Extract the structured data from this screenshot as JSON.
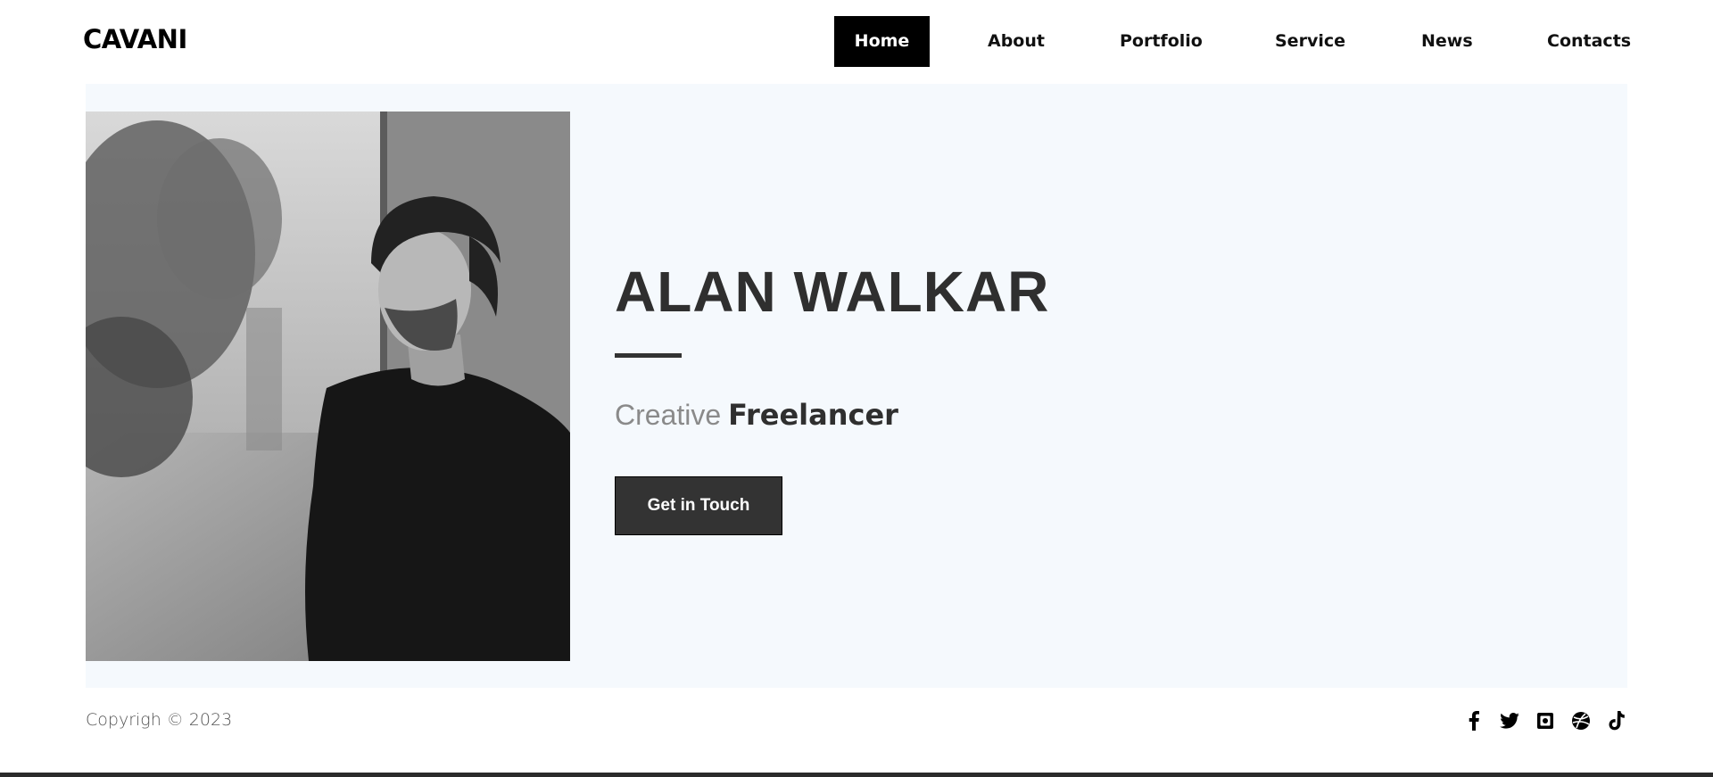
{
  "header": {
    "logo": "CAVANI",
    "nav": [
      {
        "label": "Home",
        "active": true
      },
      {
        "label": "About"
      },
      {
        "label": "Portfolio"
      },
      {
        "label": "Service"
      },
      {
        "label": "News"
      },
      {
        "label": "Contacts"
      }
    ]
  },
  "hero": {
    "name": "ALAN WALKAR",
    "tagline_light": "Creative",
    "tagline_bold": "Freelancer",
    "cta_label": "Get in Touch"
  },
  "footer": {
    "copyright": "Copyrigh © 2023",
    "socials": [
      "facebook-icon",
      "twitter-icon",
      "instagram-icon",
      "dribbble-icon",
      "tiktok-icon"
    ]
  },
  "colors": {
    "accent": "#000000",
    "hero_bg": "#f5f9fd",
    "button_bg": "#333333",
    "heading": "#2f2f2f"
  }
}
